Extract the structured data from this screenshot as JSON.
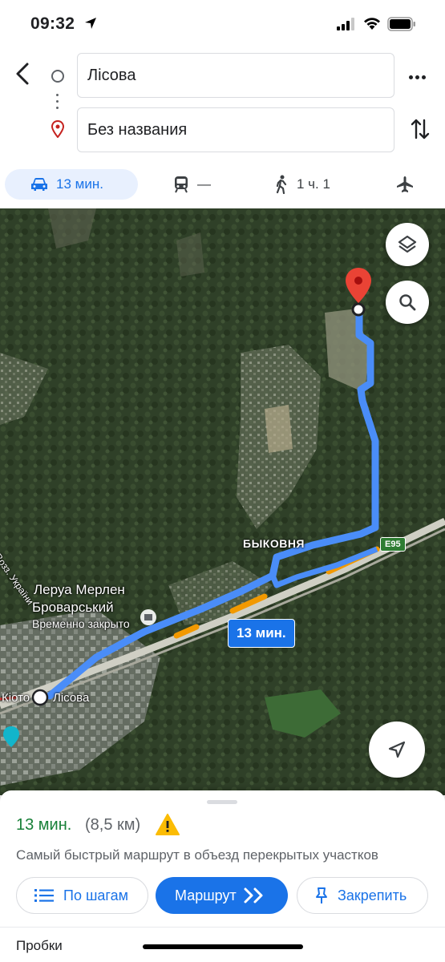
{
  "status_bar": {
    "time": "09:32"
  },
  "directions": {
    "origin": "Лісова",
    "destination": "Без названия"
  },
  "travel_modes": [
    {
      "mode": "car",
      "label": "13 мин.",
      "selected": true
    },
    {
      "mode": "transit",
      "label": "—"
    },
    {
      "mode": "walk",
      "label": "1 ч. 1"
    },
    {
      "mode": "flight",
      "label": ""
    }
  ],
  "map": {
    "labels": {
      "bykovnya": "БЫКОВНЯ",
      "store_name_1": "Леруа Мерлен",
      "store_name_2": "Броварський",
      "store_status": "Временно закрыто",
      "origin_station": "Лісова",
      "kioto": "Кіото",
      "street": "Возз. України"
    },
    "road_badge": "E95",
    "route_eta": "13 мин."
  },
  "route_summary": {
    "duration": "13 мин.",
    "distance": "(8,5 км)",
    "description": "Самый быстрый маршрут в объезд перекрытых участков"
  },
  "actions": {
    "steps_label": "По шагам",
    "start_label": "Маршрут",
    "pin_label": "Закрепить"
  },
  "traffic_label": "Пробки",
  "colors": {
    "accent": "#1a73e8",
    "duration_green": "#188038",
    "route_line": "#4a8df8",
    "traffic_orange": "#f29900",
    "pin_red": "#ea4335",
    "warning_yellow": "#fbbc04"
  }
}
